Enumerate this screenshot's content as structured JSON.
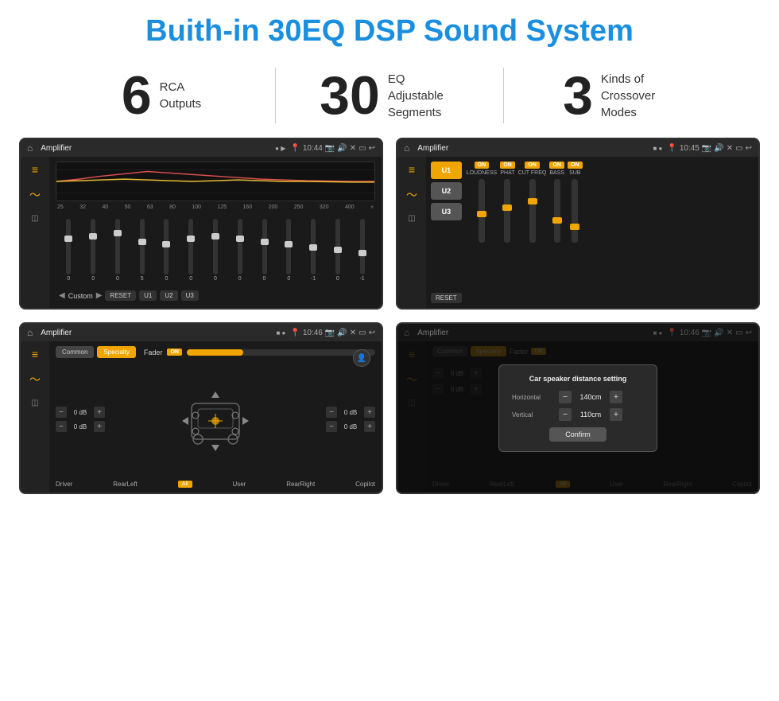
{
  "page": {
    "title": "Buith-in 30EQ DSP Sound System",
    "stats": [
      {
        "number": "6",
        "text": "RCA\nOutputs"
      },
      {
        "number": "30",
        "text": "EQ Adjustable\nSegments"
      },
      {
        "number": "3",
        "text": "Kinds of\nCrossover Modes"
      }
    ],
    "screens": [
      {
        "id": "screen-eq",
        "status_bar": {
          "title": "Amplifier",
          "time": "10:44"
        },
        "type": "eq"
      },
      {
        "id": "screen-amp2",
        "status_bar": {
          "title": "Amplifier",
          "time": "10:45"
        },
        "type": "amp2"
      },
      {
        "id": "screen-fader",
        "status_bar": {
          "title": "Amplifier",
          "time": "10:46"
        },
        "type": "fader"
      },
      {
        "id": "screen-dialog",
        "status_bar": {
          "title": "Amplifier",
          "time": "10:46"
        },
        "type": "dialog"
      }
    ],
    "eq": {
      "frequencies": [
        "25",
        "32",
        "40",
        "50",
        "63",
        "80",
        "100",
        "125",
        "160",
        "200",
        "250",
        "320",
        "400"
      ],
      "values": [
        "0",
        "0",
        "0",
        "5",
        "0",
        "0",
        "0",
        "0",
        "0",
        "0",
        "-1",
        "0",
        "-1"
      ],
      "presets": [
        "Custom",
        "RESET",
        "U1",
        "U2",
        "U3"
      ]
    },
    "amp2": {
      "u_buttons": [
        "U1",
        "U2",
        "U3"
      ],
      "controls": [
        "LOUDNESS",
        "PHAT",
        "CUT FREQ",
        "BASS",
        "SUB"
      ],
      "reset_label": "RESET"
    },
    "fader": {
      "tabs": [
        "Common",
        "Specialty"
      ],
      "fader_label": "Fader",
      "on_label": "ON",
      "db_values": [
        "0 dB",
        "0 dB",
        "0 dB",
        "0 dB"
      ],
      "bottom_labels": [
        "Driver",
        "RearLeft",
        "All",
        "User",
        "RearRight",
        "Copilot"
      ]
    },
    "dialog": {
      "title": "Car speaker distance setting",
      "horizontal_label": "Horizontal",
      "horizontal_value": "140cm",
      "vertical_label": "Vertical",
      "vertical_value": "110cm",
      "confirm_label": "Confirm",
      "tabs": [
        "Common",
        "Specialty"
      ],
      "fader_label": "Fader",
      "on_label": "ON",
      "db_values": [
        "0 dB",
        "0 dB"
      ],
      "bottom_labels": [
        "Driver",
        "RearLeft.",
        "All",
        "User",
        "RearRight",
        "Copilot"
      ]
    }
  }
}
